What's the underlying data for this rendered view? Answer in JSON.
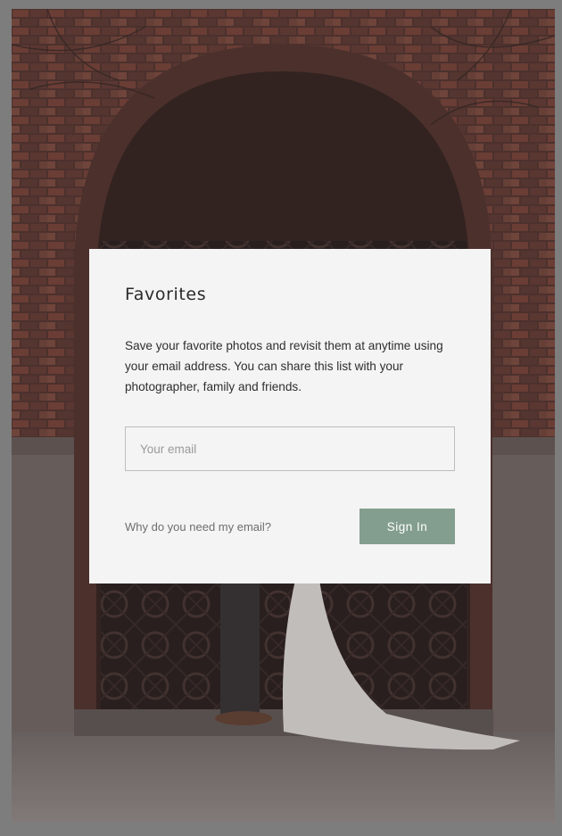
{
  "modal": {
    "title": "Favorites",
    "description": "Save your favorite photos and revisit them at anytime using your email address. You can share this list with your photographer, family and friends.",
    "email_placeholder": "Your email",
    "why_link": "Why do you need my email?",
    "signin_label": "Sign In"
  },
  "colors": {
    "accent": "#839e8e",
    "modal_background": "#f4f4f4",
    "page_background": "#7d7d7d"
  }
}
